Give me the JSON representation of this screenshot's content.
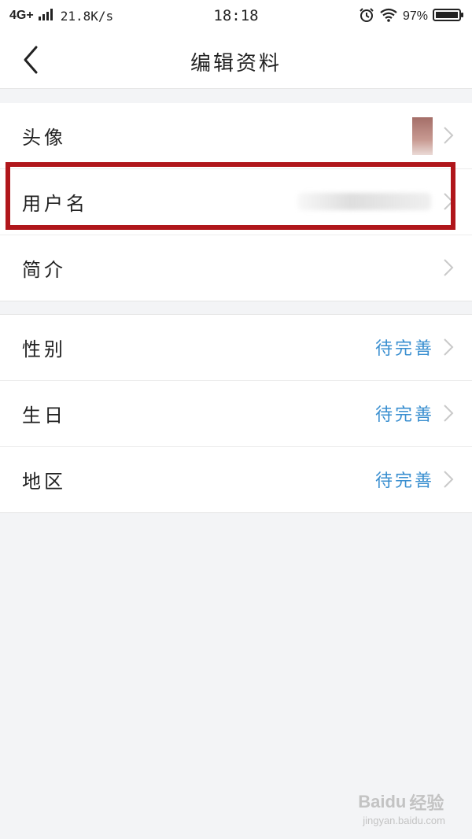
{
  "status_bar": {
    "network": "4G+",
    "speed": "21.8K/s",
    "time": "18:18",
    "battery": "97%"
  },
  "nav": {
    "title": "编辑资料"
  },
  "sections": [
    {
      "rows": [
        {
          "label": "头像"
        },
        {
          "label": "用户名"
        },
        {
          "label": "简介"
        }
      ]
    },
    {
      "rows": [
        {
          "label": "性别",
          "value": "待完善"
        },
        {
          "label": "生日",
          "value": "待完善"
        },
        {
          "label": "地区",
          "value": "待完善"
        }
      ]
    }
  ],
  "colors": {
    "accent": "#3a8fd0",
    "highlight_box": "#b0161b",
    "background": "#f3f4f6"
  },
  "watermark": {
    "brand": "Baidu",
    "brand_cn": "经验",
    "url": "jingyan.baidu.com"
  }
}
